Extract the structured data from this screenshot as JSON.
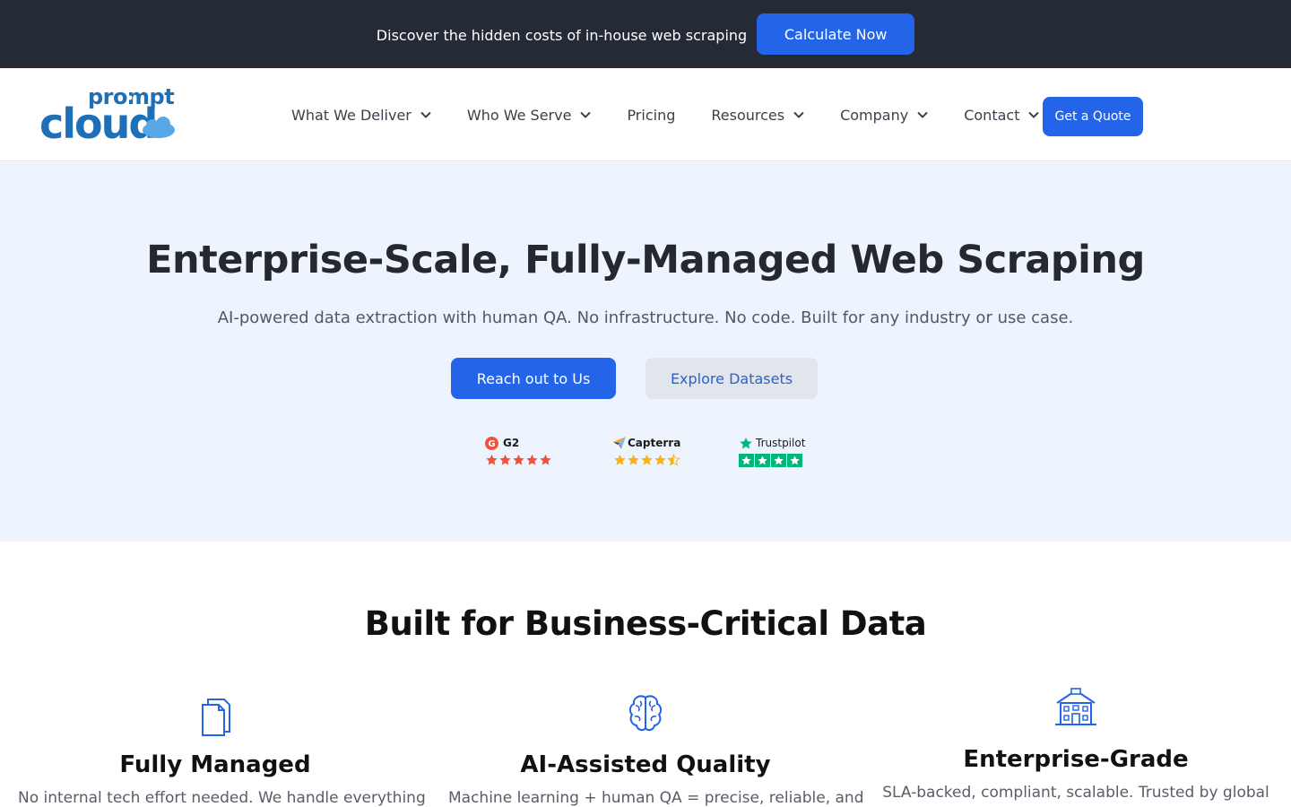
{
  "announcement": {
    "text": "Discover the hidden costs of in-house web scraping",
    "button_label": "Calculate Now"
  },
  "brand": {
    "logo_top_text": "prompt",
    "logo_bottom_text": "cloud",
    "accent_color": "#2464e8",
    "logo_color": "#1d6fb8"
  },
  "nav": {
    "items": [
      {
        "label": "What We Deliver",
        "has_dropdown": true
      },
      {
        "label": "Who We Serve",
        "has_dropdown": true
      },
      {
        "label": "Pricing",
        "has_dropdown": false
      },
      {
        "label": "Resources",
        "has_dropdown": true
      },
      {
        "label": "Company",
        "has_dropdown": true
      },
      {
        "label": "Contact",
        "has_dropdown": true
      }
    ],
    "cta_label": "Get a Quote"
  },
  "hero": {
    "title": "Enterprise-Scale, Fully-Managed Web Scraping",
    "subtitle": "AI-powered data extraction with human QA. No infrastructure. No code. Built for any industry or use case.",
    "primary_button": "Reach out to Us",
    "secondary_button": "Explore Datasets",
    "ratings": [
      {
        "platform": "G2",
        "stars": 5,
        "color": "#f1513c"
      },
      {
        "platform": "Capterra",
        "stars": 4.5,
        "color": "#f7b11b"
      },
      {
        "platform": "Trustpilot",
        "stars": 4,
        "color": "#00b67a"
      }
    ]
  },
  "features": {
    "title": "Built for Business-Critical Data",
    "items": [
      {
        "icon": "document-icon",
        "title": "Fully Managed",
        "description": "No internal tech effort needed. We handle everything"
      },
      {
        "icon": "brain-icon",
        "title": "AI-Assisted Quality",
        "description": "Machine learning + human QA = precise, reliable, and"
      },
      {
        "icon": "building-icon",
        "title": "Enterprise-Grade",
        "description": "SLA-backed, compliant, scalable. Trusted by global"
      }
    ]
  }
}
